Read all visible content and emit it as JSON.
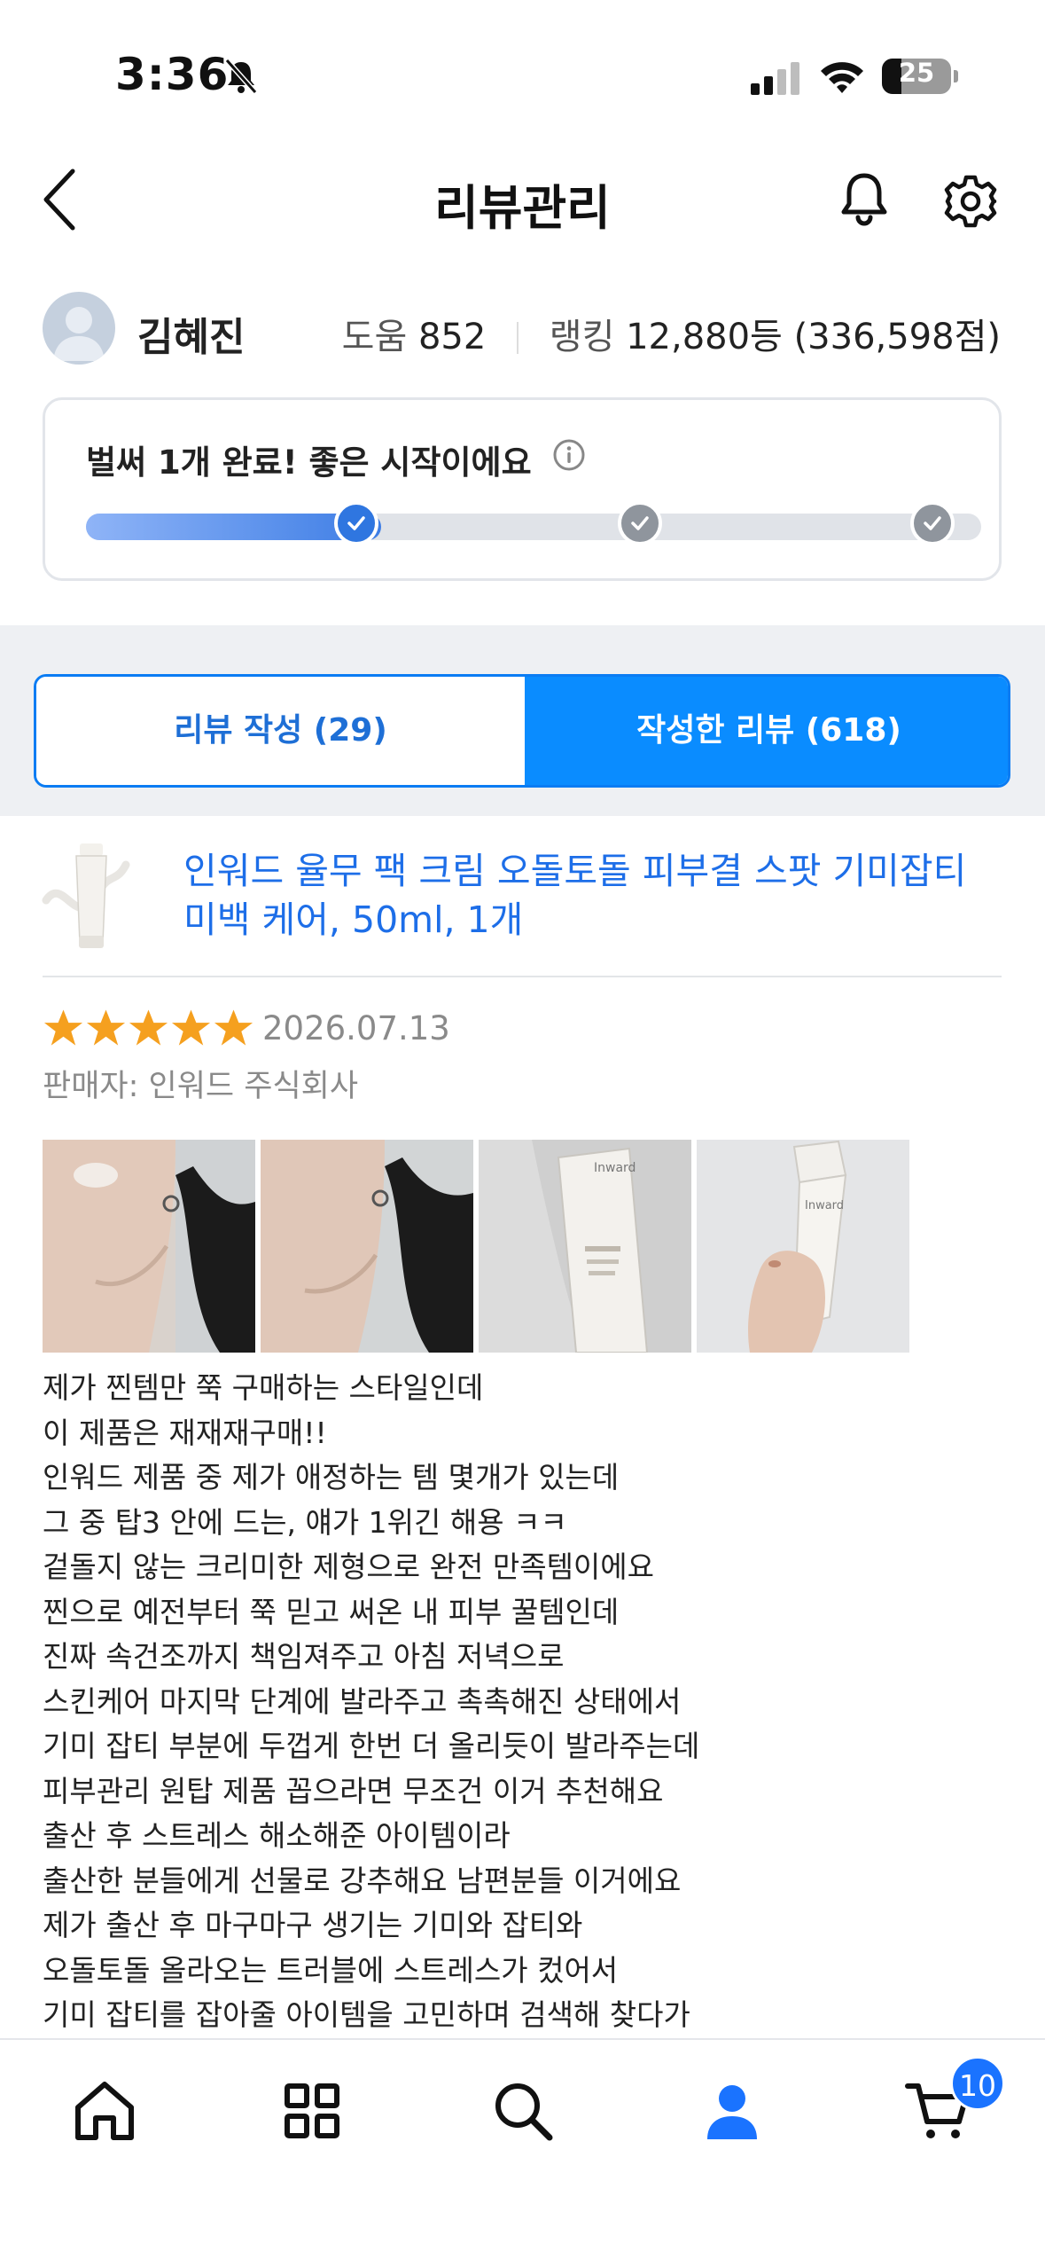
{
  "status_bar": {
    "time": "3:36",
    "battery": "25"
  },
  "header": {
    "title": "리뷰관리"
  },
  "profile": {
    "name": "김혜진",
    "help_label": "도움",
    "help_count": "852",
    "ranking_label": "랭킹",
    "ranking_value": "12,880등 (336,598점)"
  },
  "progress": {
    "title": "벌써 1개 완료! 좋은 시작이에요",
    "completed_steps": 1,
    "total_steps": 3,
    "fill_fraction": 0.33
  },
  "tabs": [
    {
      "label": "리뷰 작성 (29)",
      "active": false
    },
    {
      "label": "작성한 리뷰 (618)",
      "active": true
    }
  ],
  "review": {
    "product_title": "인워드 율무 팩 크림 오돌토돌 피부결 스팟 기미잡티 미백 케어, 50ml, 1개",
    "rating": 5,
    "date": "2026.07.13",
    "seller": "판매자: 인워드 주식회사",
    "photos": [
      "neck-photo-1",
      "neck-photo-2",
      "tube-photo-1",
      "tube-photo-2"
    ],
    "photo_brand": "Inward",
    "body_lines": [
      "제가 찐템만 쭉 구매하는 스타일인데",
      "이 제품은 재재재구매!!",
      "인워드 제품 중 제가 애정하는 템 몇개가 있는데",
      "그 중 탑3 안에 드는, 얘가 1위긴 해용 ㅋㅋ",
      "겉돌지 않는 크리미한 제형으로 완전 만족템이에요",
      "찐으로 예전부터 쭉 믿고 써온 내 피부 꿀템인데",
      "진짜 속건조까지 책임져주고 아침 저녁으로",
      "스킨케어 마지막 단계에 발라주고 촉촉해진 상태에서",
      "기미 잡티 부분에 두껍게 한번 더 올리듯이 발라주는데",
      "피부관리 원탑 제품 꼽으라면 무조건 이거 추천해요",
      "출산 후 스트레스 해소해준 아이템이라",
      "출산한 분들에게 선물로 강추해요 남편분들 이거에요",
      "제가 출산 후 마구마구 생기는 기미와 잡티와",
      "오돌토돌 올라오는 트러블에 스트레스가 컸어서",
      "기미 잡티를 잡아줄 아이템을 고민하며 검색해 찾다가"
    ]
  },
  "bottom_nav": {
    "items": [
      "home-icon",
      "category-icon",
      "search-icon",
      "mypage-icon",
      "cart-icon"
    ],
    "active": "mypage-icon",
    "cart_badge": "10"
  },
  "colors": {
    "accent": "#0a8cff",
    "link": "#1d6ee8",
    "star": "#f5a01f"
  }
}
